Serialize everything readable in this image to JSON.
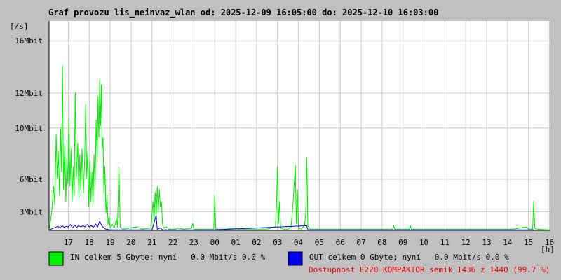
{
  "chart_data": {
    "type": "line",
    "title": "Graf provozu lis_neinvaz_wlan od: 2025-12-09 16:05:00 do: 2025-12-10 16:03:00",
    "ylabel": "[/s]",
    "xlabel": "[h]",
    "x_range": [
      16.08,
      40.05
    ],
    "ylim": [
      0,
      18
    ],
    "grid": true,
    "y_ticks": [
      {
        "value": 1.6,
        "label": "3Mbit"
      },
      {
        "value": 4.4,
        "label": "6Mbit"
      },
      {
        "value": 8.8,
        "label": "10Mbit"
      },
      {
        "value": 11.8,
        "label": "12Mbit"
      },
      {
        "value": 16.3,
        "label": "16Mbit"
      }
    ],
    "x_ticks": [
      {
        "value": 17,
        "label": "17"
      },
      {
        "value": 18,
        "label": "18"
      },
      {
        "value": 19,
        "label": "19"
      },
      {
        "value": 20,
        "label": "20"
      },
      {
        "value": 21,
        "label": "21"
      },
      {
        "value": 22,
        "label": "22"
      },
      {
        "value": 23,
        "label": "23"
      },
      {
        "value": 24,
        "label": "00"
      },
      {
        "value": 25,
        "label": "01"
      },
      {
        "value": 26,
        "label": "02"
      },
      {
        "value": 27,
        "label": "03"
      },
      {
        "value": 28,
        "label": "04"
      },
      {
        "value": 29,
        "label": "05"
      },
      {
        "value": 30,
        "label": "06"
      },
      {
        "value": 31,
        "label": "07"
      },
      {
        "value": 32,
        "label": "08"
      },
      {
        "value": 33,
        "label": "09"
      },
      {
        "value": 34,
        "label": "10"
      },
      {
        "value": 35,
        "label": "11"
      },
      {
        "value": 36,
        "label": "12"
      },
      {
        "value": 37,
        "label": "13"
      },
      {
        "value": 38,
        "label": "14"
      },
      {
        "value": 39,
        "label": "15"
      },
      {
        "value": 40,
        "label": "16"
      }
    ],
    "series": [
      {
        "color": "#00ee00",
        "points": [
          [
            16.1,
            0.2
          ],
          [
            16.2,
            1.5
          ],
          [
            16.3,
            3.8
          ],
          [
            16.35,
            2.2
          ],
          [
            16.42,
            8.2
          ],
          [
            16.47,
            4.5
          ],
          [
            16.52,
            6.8
          ],
          [
            16.58,
            3.0
          ],
          [
            16.63,
            8.8
          ],
          [
            16.68,
            5.0
          ],
          [
            16.72,
            14.2
          ],
          [
            16.77,
            3.5
          ],
          [
            16.83,
            7.5
          ],
          [
            16.88,
            2.5
          ],
          [
            16.93,
            6.2
          ],
          [
            16.98,
            4.0
          ],
          [
            17.03,
            9.5
          ],
          [
            17.08,
            3.8
          ],
          [
            17.13,
            7.0
          ],
          [
            17.18,
            2.5
          ],
          [
            17.23,
            5.5
          ],
          [
            17.28,
            3.0
          ],
          [
            17.33,
            11.8
          ],
          [
            17.38,
            4.5
          ],
          [
            17.45,
            7.5
          ],
          [
            17.5,
            2.8
          ],
          [
            17.55,
            6.5
          ],
          [
            17.6,
            3.5
          ],
          [
            17.66,
            7.0
          ],
          [
            17.72,
            3.2
          ],
          [
            17.78,
            6.0
          ],
          [
            17.83,
            10.8
          ],
          [
            17.88,
            4.5
          ],
          [
            17.93,
            6.8
          ],
          [
            17.98,
            2.0
          ],
          [
            18.03,
            6.0
          ],
          [
            18.08,
            2.5
          ],
          [
            18.13,
            5.0
          ],
          [
            18.18,
            2.2
          ],
          [
            18.23,
            6.5
          ],
          [
            18.28,
            3.5
          ],
          [
            18.33,
            9.5
          ],
          [
            18.38,
            6.0
          ],
          [
            18.42,
            11.5
          ],
          [
            18.46,
            8.0
          ],
          [
            18.5,
            13.0
          ],
          [
            18.54,
            9.0
          ],
          [
            18.58,
            12.5
          ],
          [
            18.62,
            7.0
          ],
          [
            18.66,
            8.0
          ],
          [
            18.7,
            3.0
          ],
          [
            18.75,
            5.5
          ],
          [
            18.8,
            1.5
          ],
          [
            18.85,
            3.0
          ],
          [
            18.9,
            0.5
          ],
          [
            18.95,
            1.2
          ],
          [
            19.0,
            0.2
          ],
          [
            19.1,
            0.5
          ],
          [
            19.2,
            0.2
          ],
          [
            19.3,
            1.0
          ],
          [
            19.35,
            0.3
          ],
          [
            19.42,
            5.5
          ],
          [
            19.48,
            0.3
          ],
          [
            19.6,
            0.1
          ],
          [
            19.9,
            0.2
          ],
          [
            20.3,
            0.3
          ],
          [
            20.5,
            0.1
          ],
          [
            20.95,
            0.2
          ],
          [
            21.05,
            2.5
          ],
          [
            21.1,
            0.8
          ],
          [
            21.15,
            3.3
          ],
          [
            21.2,
            1.2
          ],
          [
            21.25,
            3.8
          ],
          [
            21.3,
            1.5
          ],
          [
            21.35,
            3.5
          ],
          [
            21.4,
            2.0
          ],
          [
            21.45,
            2.5
          ],
          [
            21.5,
            0.6
          ],
          [
            21.55,
            0.2
          ],
          [
            21.7,
            0.3
          ],
          [
            21.8,
            0.1
          ],
          [
            22.1,
            0.1
          ],
          [
            22.2,
            0.2
          ],
          [
            22.5,
            0.1
          ],
          [
            22.9,
            0.2
          ],
          [
            22.95,
            0.6
          ],
          [
            23.0,
            0.1
          ],
          [
            23.5,
            0.1
          ],
          [
            23.95,
            0.1
          ],
          [
            24.0,
            3.0
          ],
          [
            24.05,
            0.1
          ],
          [
            24.5,
            0.1
          ],
          [
            25.0,
            0.2
          ],
          [
            25.1,
            0.1
          ],
          [
            25.5,
            0.1
          ],
          [
            26.1,
            0.1
          ],
          [
            26.5,
            0.1
          ],
          [
            26.9,
            0.3
          ],
          [
            26.95,
            2.0
          ],
          [
            27.0,
            5.5
          ],
          [
            27.05,
            0.6
          ],
          [
            27.1,
            2.5
          ],
          [
            27.15,
            0.2
          ],
          [
            27.3,
            0.1
          ],
          [
            27.5,
            0.1
          ],
          [
            27.65,
            0.3
          ],
          [
            27.75,
            2.5
          ],
          [
            27.85,
            5.6
          ],
          [
            27.9,
            0.6
          ],
          [
            27.95,
            3.5
          ],
          [
            28.0,
            0.2
          ],
          [
            28.15,
            0.1
          ],
          [
            28.3,
            0.5
          ],
          [
            28.35,
            1.5
          ],
          [
            28.4,
            6.2
          ],
          [
            28.45,
            0.4
          ],
          [
            28.55,
            0.1
          ],
          [
            29.0,
            0.1
          ],
          [
            30.0,
            0.1
          ],
          [
            31.0,
            0.1
          ],
          [
            32.5,
            0.1
          ],
          [
            32.55,
            0.4
          ],
          [
            32.6,
            0.1
          ],
          [
            33.0,
            0.1
          ],
          [
            33.3,
            0.1
          ],
          [
            33.35,
            0.4
          ],
          [
            33.4,
            0.1
          ],
          [
            34.5,
            0.1
          ],
          [
            35.5,
            0.1
          ],
          [
            37.0,
            0.1
          ],
          [
            38.3,
            0.1
          ],
          [
            38.9,
            0.3
          ],
          [
            39.0,
            0.1
          ],
          [
            39.2,
            0.1
          ],
          [
            39.25,
            2.5
          ],
          [
            39.3,
            0.2
          ],
          [
            39.4,
            0.1
          ],
          [
            40.0,
            0.05
          ]
        ]
      },
      {
        "color": "#0000ee",
        "points": [
          [
            16.1,
            0.05
          ],
          [
            16.3,
            0.2
          ],
          [
            16.5,
            0.35
          ],
          [
            16.6,
            0.2
          ],
          [
            16.7,
            0.4
          ],
          [
            16.8,
            0.25
          ],
          [
            16.9,
            0.35
          ],
          [
            17.0,
            0.3
          ],
          [
            17.1,
            0.5
          ],
          [
            17.2,
            0.2
          ],
          [
            17.3,
            0.45
          ],
          [
            17.4,
            0.25
          ],
          [
            17.5,
            0.4
          ],
          [
            17.6,
            0.3
          ],
          [
            17.7,
            0.4
          ],
          [
            17.8,
            0.3
          ],
          [
            17.9,
            0.5
          ],
          [
            18.0,
            0.3
          ],
          [
            18.1,
            0.4
          ],
          [
            18.2,
            0.25
          ],
          [
            18.3,
            0.55
          ],
          [
            18.4,
            0.3
          ],
          [
            18.5,
            0.8
          ],
          [
            18.6,
            0.4
          ],
          [
            18.7,
            0.2
          ],
          [
            18.8,
            0.1
          ],
          [
            19.0,
            0.05
          ],
          [
            21.0,
            0.05
          ],
          [
            21.2,
            1.3
          ],
          [
            21.25,
            0.1
          ],
          [
            21.4,
            0.2
          ],
          [
            21.5,
            0.05
          ],
          [
            24.0,
            0.05
          ],
          [
            28.4,
            0.4
          ],
          [
            28.45,
            0.05
          ],
          [
            39.25,
            0.05
          ]
        ]
      }
    ],
    "legend": [
      {
        "color": "#00ee00",
        "label": "IN celkem 5 Gbyte; nyní   0.0 Mbit/s 0.0 %"
      },
      {
        "color": "#0000ee",
        "label": "OUT celkem 0 Gbyte; nyní   0.0 Mbit/s 0.0 %"
      }
    ],
    "annotation": "Dostupnost E220 KOMPAKTOR semik 1436 z 1440 (99.7 %)",
    "annotation_color": "#ee0000"
  }
}
